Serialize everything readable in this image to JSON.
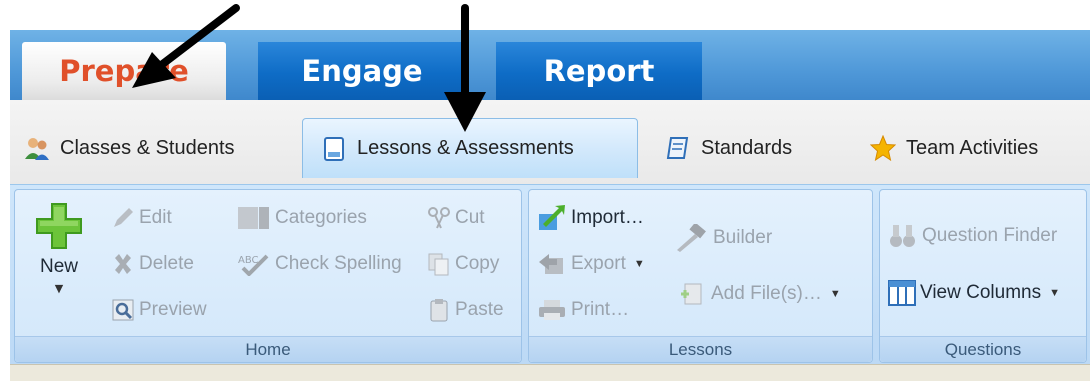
{
  "top_tabs": {
    "prepare": "Prepare",
    "engage": "Engage",
    "report": "Report"
  },
  "sub_tabs": {
    "classes": "Classes & Students",
    "lessons": "Lessons & Assessments",
    "standards": "Standards",
    "team": "Team Activities"
  },
  "ribbon": {
    "home": {
      "label": "Home",
      "new": "New",
      "edit": "Edit",
      "delete": "Delete",
      "preview": "Preview",
      "categories": "Categories",
      "check_spelling": "Check Spelling",
      "cut": "Cut",
      "copy": "Copy",
      "paste": "Paste"
    },
    "lessons": {
      "label": "Lessons",
      "import": "Import…",
      "export": "Export",
      "print": "Print…",
      "builder": "Builder",
      "add_files": "Add File(s)…"
    },
    "questions": {
      "label": "Questions",
      "question_finder": "Question Finder",
      "view_columns": "View Columns"
    }
  },
  "colors": {
    "active_tab_text": "#e0502a",
    "inactive_tab_bg": "#0e6cc6",
    "ribbon_bg": "#cfe6fb",
    "new_icon_green": "#6cc43a",
    "disabled_text": "#9aa3ad"
  },
  "icons": [
    "users-icon",
    "document-icon",
    "book-icon",
    "star-icon",
    "plus-icon",
    "pencil-icon",
    "x-icon",
    "magnifier-icon",
    "categories-icon",
    "spellcheck-icon",
    "scissors-icon",
    "copy-icon",
    "clipboard-icon",
    "import-arrow-icon",
    "export-icon",
    "printer-icon",
    "hammer-icon",
    "add-file-icon",
    "binoculars-icon",
    "columns-icon"
  ]
}
